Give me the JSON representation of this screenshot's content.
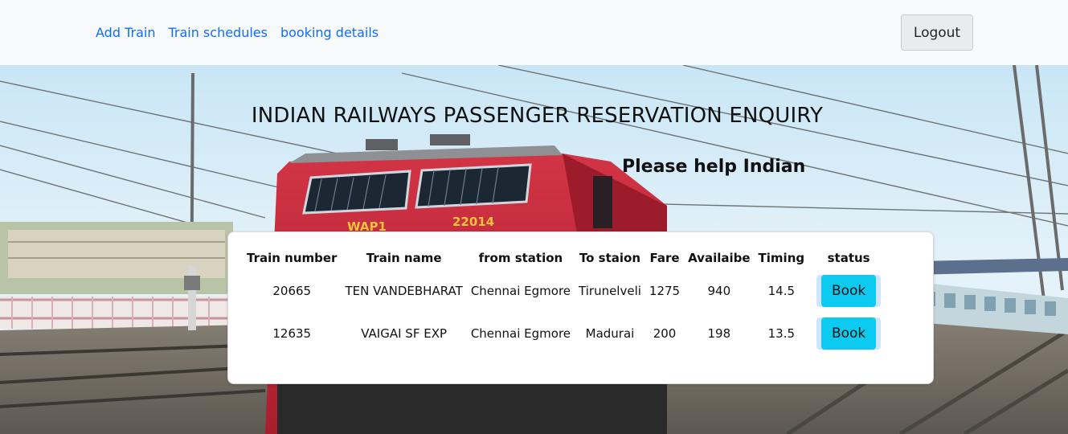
{
  "nav": {
    "links": [
      "Add Train",
      "Train schedules",
      "booking details"
    ],
    "logout_label": "Logout"
  },
  "hero": {
    "title": "INDIAN RAILWAYS PASSENGER RESERVATION ENQUIRY",
    "subtitle": "Please help Indian",
    "locomotive_markings": [
      "WAP1",
      "22014"
    ]
  },
  "table": {
    "headers": [
      "Train number",
      "Train name",
      "from station",
      "To staion",
      "Fare",
      "Availaibe",
      "Timing",
      "status"
    ],
    "rows": [
      {
        "number": "20665",
        "name": "TEN VANDEBHARAT",
        "from": "Chennai Egmore",
        "to": "Tirunelveli",
        "fare": "1275",
        "available": "940",
        "timing": "14.5",
        "action": "Book"
      },
      {
        "number": "12635",
        "name": "VAIGAI SF EXP",
        "from": "Chennai Egmore",
        "to": "Madurai",
        "fare": "200",
        "available": "198",
        "timing": "13.5",
        "action": "Book"
      }
    ]
  },
  "colors": {
    "link": "#0d6efd",
    "book_button": "#0dcaf0",
    "navbar_bg": "#f8f9fa",
    "locomotive_red": "#c8283a"
  }
}
